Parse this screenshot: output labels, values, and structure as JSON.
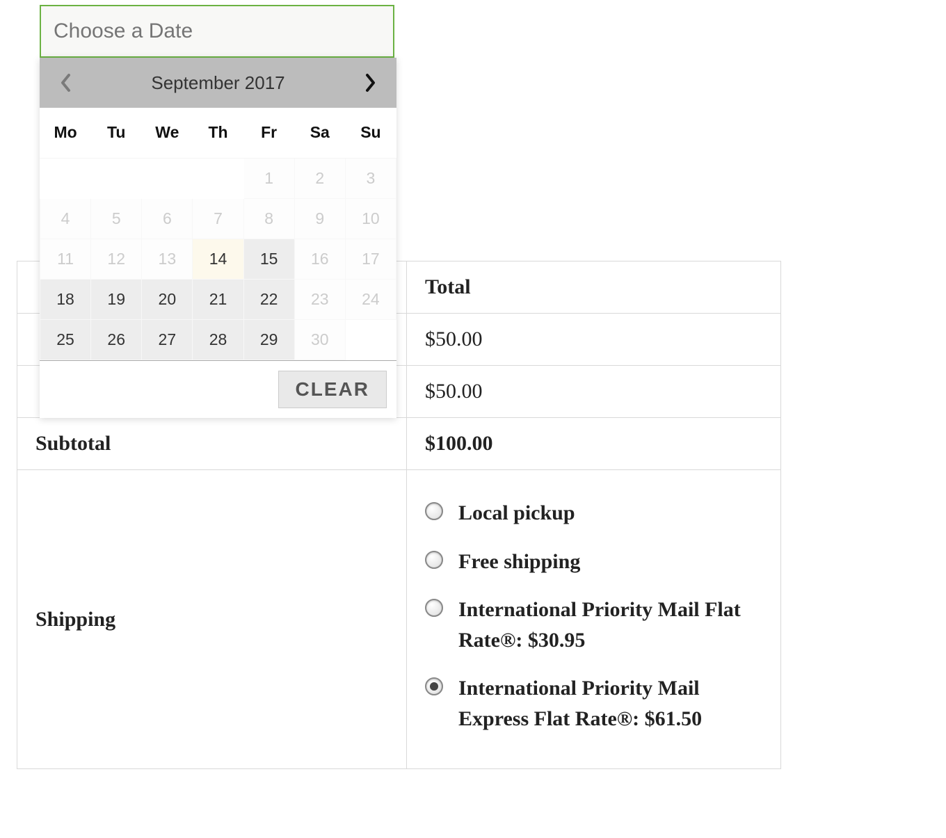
{
  "date_input": {
    "placeholder": "Choose a Date",
    "value": ""
  },
  "datepicker": {
    "title": "September 2017",
    "clear_label": "CLEAR",
    "weekdays": [
      "Mo",
      "Tu",
      "We",
      "Th",
      "Fr",
      "Sa",
      "Su"
    ],
    "rows": [
      [
        {
          "day": "",
          "state": "empty"
        },
        {
          "day": "",
          "state": "empty"
        },
        {
          "day": "",
          "state": "empty"
        },
        {
          "day": "",
          "state": "empty"
        },
        {
          "day": "1",
          "state": "disabled"
        },
        {
          "day": "2",
          "state": "disabled"
        },
        {
          "day": "3",
          "state": "disabled"
        }
      ],
      [
        {
          "day": "4",
          "state": "disabled"
        },
        {
          "day": "5",
          "state": "disabled"
        },
        {
          "day": "6",
          "state": "disabled"
        },
        {
          "day": "7",
          "state": "disabled"
        },
        {
          "day": "8",
          "state": "disabled"
        },
        {
          "day": "9",
          "state": "disabled"
        },
        {
          "day": "10",
          "state": "disabled"
        }
      ],
      [
        {
          "day": "11",
          "state": "disabled"
        },
        {
          "day": "12",
          "state": "disabled"
        },
        {
          "day": "13",
          "state": "disabled"
        },
        {
          "day": "14",
          "state": "today"
        },
        {
          "day": "15",
          "state": "available"
        },
        {
          "day": "16",
          "state": "disabled"
        },
        {
          "day": "17",
          "state": "disabled"
        }
      ],
      [
        {
          "day": "18",
          "state": "available"
        },
        {
          "day": "19",
          "state": "available"
        },
        {
          "day": "20",
          "state": "available"
        },
        {
          "day": "21",
          "state": "available"
        },
        {
          "day": "22",
          "state": "available"
        },
        {
          "day": "23",
          "state": "disabled"
        },
        {
          "day": "24",
          "state": "disabled"
        }
      ],
      [
        {
          "day": "25",
          "state": "available"
        },
        {
          "day": "26",
          "state": "available"
        },
        {
          "day": "27",
          "state": "available"
        },
        {
          "day": "28",
          "state": "available"
        },
        {
          "day": "29",
          "state": "available"
        },
        {
          "day": "30",
          "state": "disabled"
        },
        {
          "day": "",
          "state": "empty"
        }
      ]
    ]
  },
  "cart": {
    "total_header": "Total",
    "rows": [
      {
        "label": "",
        "value": "$50.00"
      },
      {
        "label": "",
        "value": "$50.00"
      }
    ],
    "subtotal_label": "Subtotal",
    "subtotal_value": "$100.00",
    "shipping_label": "Shipping",
    "shipping_options": [
      {
        "label": "Local pickup",
        "selected": false
      },
      {
        "label": "Free shipping",
        "selected": false
      },
      {
        "label": "International Priority Mail Flat Rate®: $30.95",
        "selected": false
      },
      {
        "label": "International Priority Mail Express Flat Rate®: $61.50",
        "selected": true
      }
    ]
  }
}
